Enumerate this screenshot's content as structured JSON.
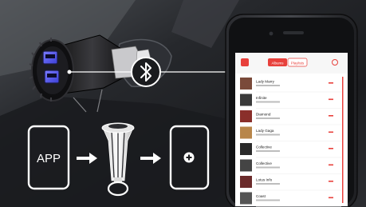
{
  "flow": {
    "app_label": "APP",
    "bluetooth_icon": "bluetooth-icon",
    "arrow_icon": "right-arrow-icon",
    "add_icon": "plus-circle-icon"
  },
  "phone": {
    "app_tabs": [
      "Albums",
      "Playlists"
    ],
    "song_titles": [
      "Lady Marry",
      "Infinite",
      "Diamond",
      "Lady Gaga",
      "Collective",
      "Collective",
      "Lotus Info",
      "Coast"
    ],
    "accent_color": "#e8413c"
  }
}
